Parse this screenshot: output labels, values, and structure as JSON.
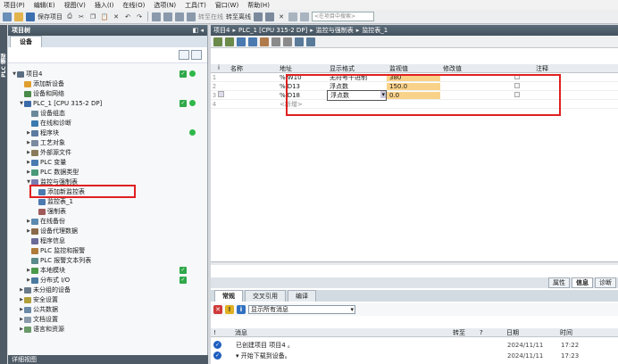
{
  "menu": [
    "项目(P)",
    "编辑(E)",
    "视图(V)",
    "插入(I)",
    "在线(O)",
    "选项(N)",
    "工具(T)",
    "窗口(W)",
    "帮助(H)"
  ],
  "toolbar": {
    "save_label": "保存项目",
    "goonline": "转至在线",
    "gooffline": "转至离线",
    "search_placeholder": "<在项目中搜索>"
  },
  "left_panel": {
    "title": "项目树",
    "devices_tab": "设备",
    "tree": [
      {
        "label": "项目4",
        "level": 0,
        "arrow": "▼"
      },
      {
        "label": "添加新设备",
        "level": 1,
        "arrow": ""
      },
      {
        "label": "设备和网络",
        "level": 1,
        "arrow": ""
      },
      {
        "label": "PLC_1 [CPU 315-2 DP]",
        "level": 1,
        "arrow": "▼"
      },
      {
        "label": "设备组态",
        "level": 2,
        "arrow": ""
      },
      {
        "label": "在线和诊断",
        "level": 2,
        "arrow": ""
      },
      {
        "label": "程序块",
        "level": 2,
        "arrow": "▶"
      },
      {
        "label": "工艺对象",
        "level": 2,
        "arrow": "▶"
      },
      {
        "label": "外部源文件",
        "level": 2,
        "arrow": "▶"
      },
      {
        "label": "PLC 变量",
        "level": 2,
        "arrow": "▶"
      },
      {
        "label": "PLC 数据类型",
        "level": 2,
        "arrow": "▶"
      },
      {
        "label": "监控与强制表",
        "level": 2,
        "arrow": "▼"
      },
      {
        "label": "添加新监控表",
        "level": 3,
        "arrow": ""
      },
      {
        "label": "监控表_1",
        "level": 3,
        "arrow": ""
      },
      {
        "label": "强制表",
        "level": 3,
        "arrow": ""
      },
      {
        "label": "在线备份",
        "level": 2,
        "arrow": "▶"
      },
      {
        "label": "设备代理数据",
        "level": 2,
        "arrow": "▶"
      },
      {
        "label": "程序信息",
        "level": 2,
        "arrow": ""
      },
      {
        "label": "PLC 监控和报警",
        "level": 2,
        "arrow": ""
      },
      {
        "label": "PLC 报警文本列表",
        "level": 2,
        "arrow": ""
      },
      {
        "label": "本地模块",
        "level": 2,
        "arrow": "▶"
      },
      {
        "label": "分布式 I/O",
        "level": 2,
        "arrow": "▶"
      },
      {
        "label": "未分组的设备",
        "level": 1,
        "arrow": "▶"
      },
      {
        "label": "安全设置",
        "level": 1,
        "arrow": "▶"
      },
      {
        "label": "公共数据",
        "level": 1,
        "arrow": "▶"
      },
      {
        "label": "文档设置",
        "level": 1,
        "arrow": "▶"
      },
      {
        "label": "语言和资源",
        "level": 1,
        "arrow": "▶"
      }
    ],
    "details_label": "详细视图"
  },
  "breadcrumb": [
    "项目4",
    "PLC_1 [CPU 315-2 DP]",
    "监控与强制表",
    "监控表_1"
  ],
  "watch_table": {
    "headers": [
      "i",
      "名称",
      "地址",
      "显示格式",
      "监视值",
      "修改值",
      "",
      "注释"
    ],
    "rows": [
      {
        "num": "1",
        "name": "",
        "address": "%IW10",
        "format": "无符号十进制",
        "monitor": "380",
        "modify": "",
        "comment": ""
      },
      {
        "num": "2",
        "name": "",
        "address": "%ID13",
        "format": "浮点数",
        "monitor": "150.0",
        "modify": "",
        "comment": ""
      },
      {
        "num": "3",
        "name": "",
        "address": "%ID18",
        "format": "浮点数",
        "monitor": "0.0",
        "modify": "",
        "comment": ""
      },
      {
        "num": "4",
        "name": "",
        "address": "<新增>",
        "format": "",
        "monitor": "",
        "modify": "",
        "comment": ""
      }
    ]
  },
  "inspector": {
    "prop_tabs": [
      "属性",
      "信息",
      "诊断"
    ],
    "tabs": [
      "常规",
      "交叉引用",
      "编译"
    ],
    "filter_value": "显示所有消息",
    "msg_headers": [
      "!",
      "消息",
      "转至",
      "?",
      "日期",
      "时间"
    ],
    "messages": [
      {
        "text": "已创建项目 项目4 。",
        "date": "2024/11/11",
        "time": "17:22"
      },
      {
        "text": "开始下载到设备。",
        "date": "2024/11/11",
        "time": "17:23"
      }
    ]
  }
}
